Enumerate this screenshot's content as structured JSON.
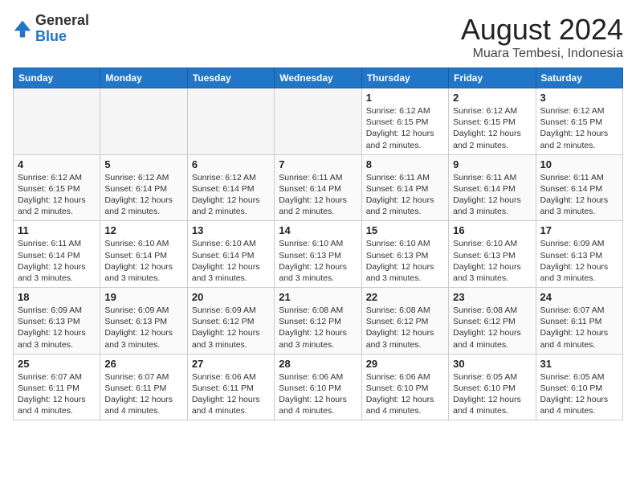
{
  "logo": {
    "general": "General",
    "blue": "Blue"
  },
  "header": {
    "title": "August 2024",
    "subtitle": "Muara Tembesi, Indonesia"
  },
  "weekdays": [
    "Sunday",
    "Monday",
    "Tuesday",
    "Wednesday",
    "Thursday",
    "Friday",
    "Saturday"
  ],
  "weeks": [
    [
      {
        "day": "",
        "info": ""
      },
      {
        "day": "",
        "info": ""
      },
      {
        "day": "",
        "info": ""
      },
      {
        "day": "",
        "info": ""
      },
      {
        "day": "1",
        "info": "Sunrise: 6:12 AM\nSunset: 6:15 PM\nDaylight: 12 hours and 2 minutes."
      },
      {
        "day": "2",
        "info": "Sunrise: 6:12 AM\nSunset: 6:15 PM\nDaylight: 12 hours and 2 minutes."
      },
      {
        "day": "3",
        "info": "Sunrise: 6:12 AM\nSunset: 6:15 PM\nDaylight: 12 hours and 2 minutes."
      }
    ],
    [
      {
        "day": "4",
        "info": "Sunrise: 6:12 AM\nSunset: 6:15 PM\nDaylight: 12 hours and 2 minutes."
      },
      {
        "day": "5",
        "info": "Sunrise: 6:12 AM\nSunset: 6:14 PM\nDaylight: 12 hours and 2 minutes."
      },
      {
        "day": "6",
        "info": "Sunrise: 6:12 AM\nSunset: 6:14 PM\nDaylight: 12 hours and 2 minutes."
      },
      {
        "day": "7",
        "info": "Sunrise: 6:11 AM\nSunset: 6:14 PM\nDaylight: 12 hours and 2 minutes."
      },
      {
        "day": "8",
        "info": "Sunrise: 6:11 AM\nSunset: 6:14 PM\nDaylight: 12 hours and 2 minutes."
      },
      {
        "day": "9",
        "info": "Sunrise: 6:11 AM\nSunset: 6:14 PM\nDaylight: 12 hours and 3 minutes."
      },
      {
        "day": "10",
        "info": "Sunrise: 6:11 AM\nSunset: 6:14 PM\nDaylight: 12 hours and 3 minutes."
      }
    ],
    [
      {
        "day": "11",
        "info": "Sunrise: 6:11 AM\nSunset: 6:14 PM\nDaylight: 12 hours and 3 minutes."
      },
      {
        "day": "12",
        "info": "Sunrise: 6:10 AM\nSunset: 6:14 PM\nDaylight: 12 hours and 3 minutes."
      },
      {
        "day": "13",
        "info": "Sunrise: 6:10 AM\nSunset: 6:14 PM\nDaylight: 12 hours and 3 minutes."
      },
      {
        "day": "14",
        "info": "Sunrise: 6:10 AM\nSunset: 6:13 PM\nDaylight: 12 hours and 3 minutes."
      },
      {
        "day": "15",
        "info": "Sunrise: 6:10 AM\nSunset: 6:13 PM\nDaylight: 12 hours and 3 minutes."
      },
      {
        "day": "16",
        "info": "Sunrise: 6:10 AM\nSunset: 6:13 PM\nDaylight: 12 hours and 3 minutes."
      },
      {
        "day": "17",
        "info": "Sunrise: 6:09 AM\nSunset: 6:13 PM\nDaylight: 12 hours and 3 minutes."
      }
    ],
    [
      {
        "day": "18",
        "info": "Sunrise: 6:09 AM\nSunset: 6:13 PM\nDaylight: 12 hours and 3 minutes."
      },
      {
        "day": "19",
        "info": "Sunrise: 6:09 AM\nSunset: 6:13 PM\nDaylight: 12 hours and 3 minutes."
      },
      {
        "day": "20",
        "info": "Sunrise: 6:09 AM\nSunset: 6:12 PM\nDaylight: 12 hours and 3 minutes."
      },
      {
        "day": "21",
        "info": "Sunrise: 6:08 AM\nSunset: 6:12 PM\nDaylight: 12 hours and 3 minutes."
      },
      {
        "day": "22",
        "info": "Sunrise: 6:08 AM\nSunset: 6:12 PM\nDaylight: 12 hours and 3 minutes."
      },
      {
        "day": "23",
        "info": "Sunrise: 6:08 AM\nSunset: 6:12 PM\nDaylight: 12 hours and 4 minutes."
      },
      {
        "day": "24",
        "info": "Sunrise: 6:07 AM\nSunset: 6:11 PM\nDaylight: 12 hours and 4 minutes."
      }
    ],
    [
      {
        "day": "25",
        "info": "Sunrise: 6:07 AM\nSunset: 6:11 PM\nDaylight: 12 hours and 4 minutes."
      },
      {
        "day": "26",
        "info": "Sunrise: 6:07 AM\nSunset: 6:11 PM\nDaylight: 12 hours and 4 minutes."
      },
      {
        "day": "27",
        "info": "Sunrise: 6:06 AM\nSunset: 6:11 PM\nDaylight: 12 hours and 4 minutes."
      },
      {
        "day": "28",
        "info": "Sunrise: 6:06 AM\nSunset: 6:10 PM\nDaylight: 12 hours and 4 minutes."
      },
      {
        "day": "29",
        "info": "Sunrise: 6:06 AM\nSunset: 6:10 PM\nDaylight: 12 hours and 4 minutes."
      },
      {
        "day": "30",
        "info": "Sunrise: 6:05 AM\nSunset: 6:10 PM\nDaylight: 12 hours and 4 minutes."
      },
      {
        "day": "31",
        "info": "Sunrise: 6:05 AM\nSunset: 6:10 PM\nDaylight: 12 hours and 4 minutes."
      }
    ]
  ]
}
